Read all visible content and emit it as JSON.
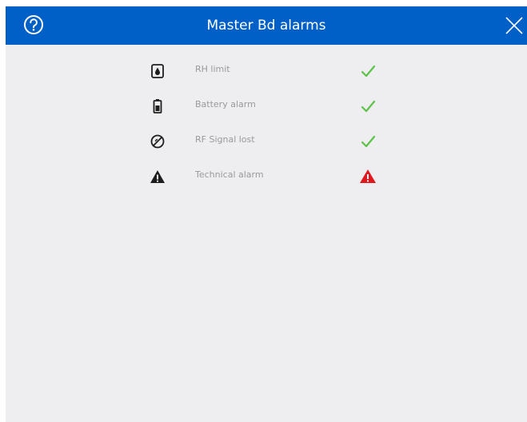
{
  "header": {
    "title": "Master Bd alarms",
    "background_color": "#0060c8",
    "help_icon": "question-circle-icon",
    "close_icon": "close-icon"
  },
  "alarms": [
    {
      "label": "RH limit",
      "type_icon": "humidity-drop-icon",
      "status": "ok",
      "status_icon": "checkmark-icon"
    },
    {
      "label": "Battery alarm",
      "type_icon": "battery-icon",
      "status": "ok",
      "status_icon": "checkmark-icon"
    },
    {
      "label": "RF Signal lost",
      "type_icon": "no-signal-icon",
      "status": "ok",
      "status_icon": "checkmark-icon"
    },
    {
      "label": "Technical alarm",
      "type_icon": "warning-triangle-icon",
      "status": "alarm",
      "status_icon": "red-warning-icon"
    }
  ],
  "colors": {
    "ok": "#5cc24a",
    "alarm": "#e0181e",
    "panel_background": "#eeeef0"
  }
}
